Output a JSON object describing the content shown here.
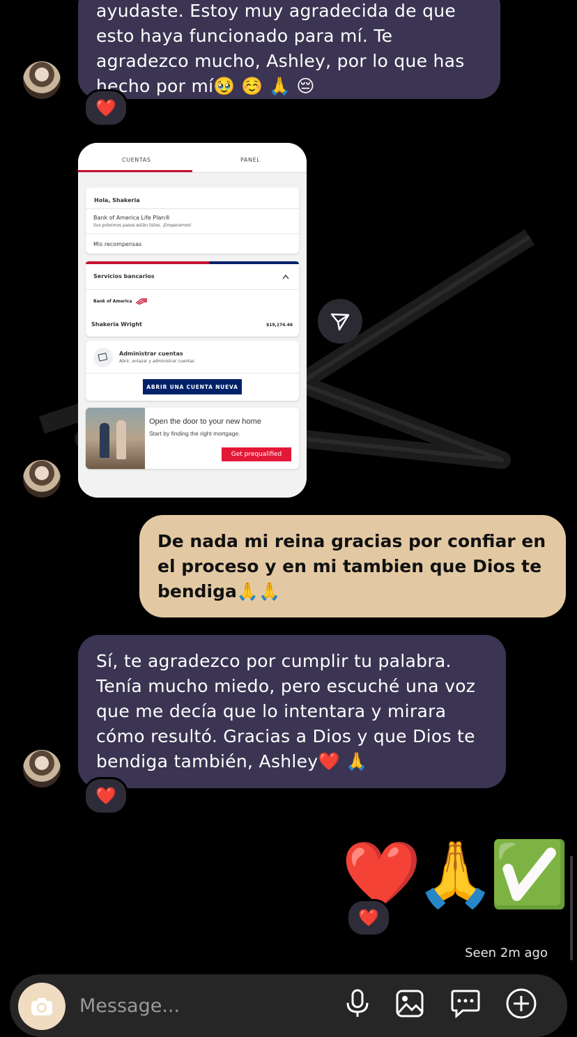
{
  "messages": {
    "first_incoming": "ayudaste. Estoy muy agradecida de que esto haya funcionado para mí. Te agradezco mucho, Ashley, por lo que has hecho por mí🥹 ☺️ 🙏 😔",
    "first_reaction": "❤️",
    "outgoing_reply": "De nada mi reina gracias por confiar en el proceso y en mi tambien que Dios te bendiga🙏🙏",
    "second_incoming": "Sí, te agradezco por cumplir tu palabra. Tenía mucho miedo, pero escuché una voz que me decía que lo intentara y mirara cómo resultó. Gracias a Dios y que Dios te bendiga también, Ashley❤️ 🙏",
    "second_reaction": "❤️",
    "emoji_message": [
      "❤️",
      "🙏",
      "✅"
    ],
    "emoji_reaction": "❤️",
    "seen_status": "Seen 2m ago"
  },
  "bank_screenshot": {
    "tabs": [
      "CUENTAS",
      "PANEL"
    ],
    "greeting": "Hola, Shakeria",
    "life_plan_title": "Bank of America Life Plan®",
    "life_plan_subtitle": "Sus próximos pasos están listos. ¡Empecemos!",
    "rewards": "Mis recompensas",
    "section_title": "Servicios bancarios",
    "bank_name": "Bank of America",
    "account_holder": "Shakeria Wright",
    "balance": "$19,174.46",
    "manage_title": "Administrar cuentas",
    "manage_subtitle": "Abrir, enlazar y administrar cuentas",
    "open_account_button": "ABRIR UNA CUENTA NUEVA",
    "promo_title": "Open the door to your new home",
    "promo_subtitle": "Start by finding the right mortgage.",
    "promo_button": "Get prequalified"
  },
  "composer": {
    "placeholder": "Message..."
  },
  "colors": {
    "incoming_bubble": "#3b3452",
    "outgoing_bubble": "#e3c9a3",
    "boa_red": "#e31837",
    "boa_navy": "#012169"
  },
  "icons": [
    "camera-icon",
    "microphone-icon",
    "gallery-icon",
    "sticker-icon",
    "plus-circle-icon",
    "send-icon"
  ]
}
